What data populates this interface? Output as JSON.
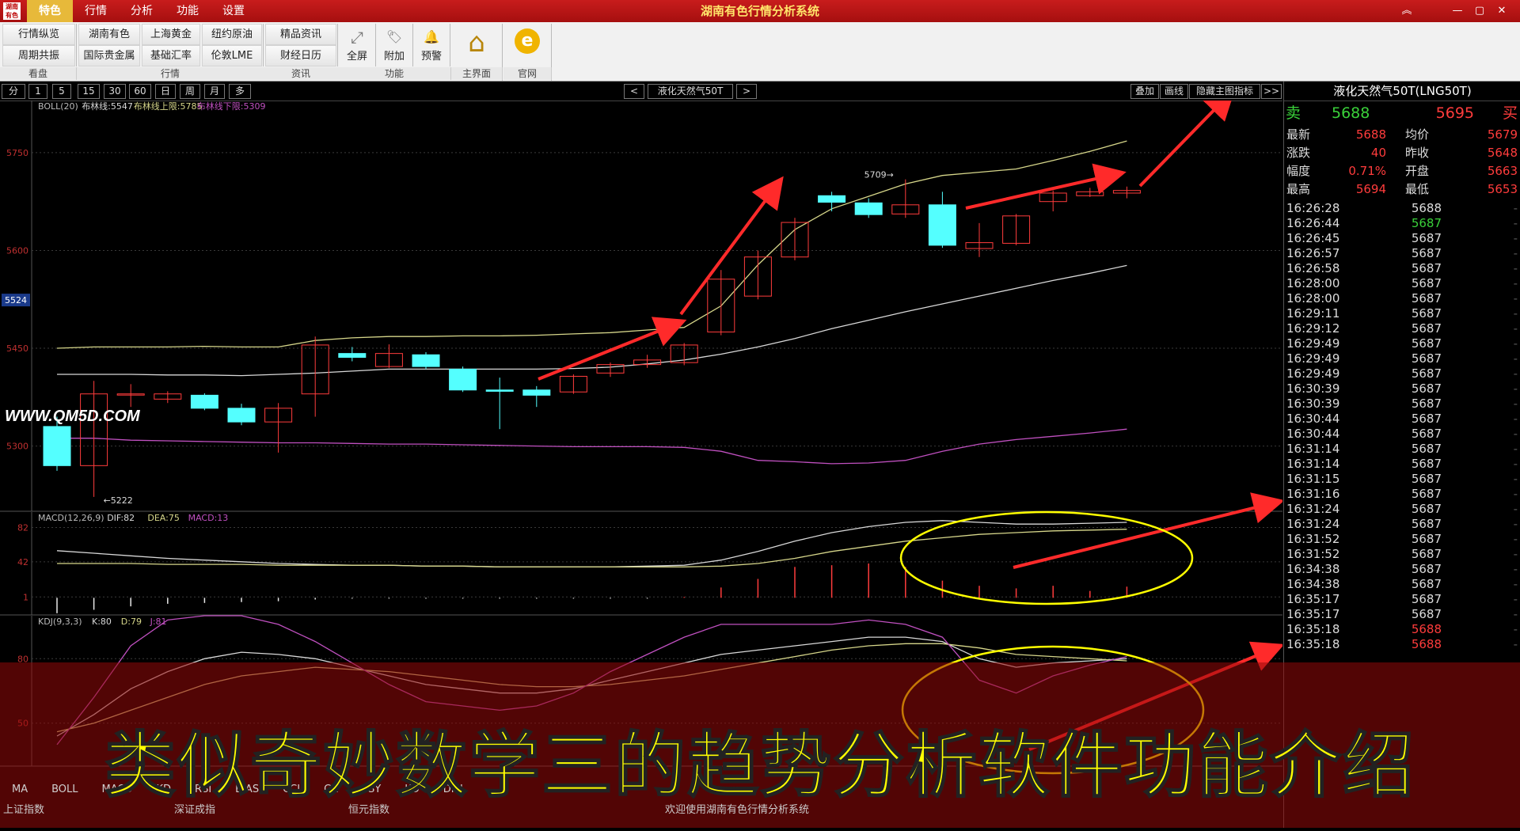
{
  "app": {
    "title": "湖南有色行情分析系统",
    "logo_text": "湖南有色"
  },
  "menu": [
    "特色",
    "行情",
    "分析",
    "功能",
    "设置"
  ],
  "window_controls": [
    "︽",
    "—",
    "▢",
    "✕"
  ],
  "toolbar": {
    "groups": [
      {
        "label": "看盘",
        "buttons": [
          "行情纵览",
          "周期共振"
        ]
      },
      {
        "label": "行情",
        "buttons": [
          "湖南有色",
          "上海黄金",
          "国际贵金属",
          "基础汇率",
          "纽约原油",
          "伦敦LME"
        ]
      },
      {
        "label": "资讯",
        "buttons": [
          "精品资讯",
          "财经日历"
        ]
      }
    ],
    "big_buttons": [
      {
        "label": "全屏",
        "icon": "fullscreen-icon",
        "glyph": "⤢"
      },
      {
        "label": "附加",
        "icon": "tag-icon",
        "glyph": "🏷"
      },
      {
        "label": "预警",
        "icon": "bell-icon",
        "glyph": "🔔"
      }
    ],
    "big_group_label": "功能",
    "home": {
      "label": "主界面",
      "icon": "home-icon",
      "glyph": "⌂"
    },
    "website": {
      "label": "官网",
      "icon": "globe-icon",
      "glyph": "e"
    }
  },
  "periods": [
    "分",
    "1",
    "5",
    "15",
    "30",
    "60",
    "日",
    "周",
    "月",
    "多"
  ],
  "symbol_nav": {
    "prev": "<",
    "name": "液化天然气50T",
    "next": ">"
  },
  "chart_tools": [
    "叠加",
    "画线",
    "隐藏主图指标",
    ">>"
  ],
  "watermark": "WWW.QM5D.COM",
  "chart_data": [
    {
      "type": "candlestick",
      "title": "BOLL(20)",
      "legend": [
        {
          "label": "布林线:5547",
          "color": "#d8d8d8"
        },
        {
          "label": "布林线上限:5785",
          "color": "#d6d68a"
        },
        {
          "label": "布林线下限:5309",
          "color": "#c050c0"
        }
      ],
      "ylim": [
        5200,
        5830
      ],
      "y_ticks": [
        5300,
        5450,
        5600,
        5750
      ],
      "current_price_label": "5524",
      "annotations": [
        {
          "text": "5709",
          "index": 23
        },
        {
          "text": "5222",
          "index": 1
        }
      ],
      "candles": [
        {
          "o": 5330,
          "c": 5270,
          "h": 5345,
          "l": 5262
        },
        {
          "o": 5270,
          "c": 5380,
          "h": 5400,
          "l": 5222
        },
        {
          "o": 5380,
          "c": 5380,
          "h": 5395,
          "l": 5360
        },
        {
          "o": 5372,
          "c": 5380,
          "h": 5384,
          "l": 5366
        },
        {
          "o": 5378,
          "c": 5358,
          "h": 5381,
          "l": 5355
        },
        {
          "o": 5358,
          "c": 5337,
          "h": 5365,
          "l": 5332
        },
        {
          "o": 5337,
          "c": 5358,
          "h": 5366,
          "l": 5290
        },
        {
          "o": 5380,
          "c": 5455,
          "h": 5468,
          "l": 5345
        },
        {
          "o": 5442,
          "c": 5436,
          "h": 5452,
          "l": 5430
        },
        {
          "o": 5422,
          "c": 5442,
          "h": 5456,
          "l": 5420
        },
        {
          "o": 5440,
          "c": 5422,
          "h": 5444,
          "l": 5418
        },
        {
          "o": 5418,
          "c": 5386,
          "h": 5422,
          "l": 5383
        },
        {
          "o": 5386,
          "c": 5384,
          "h": 5405,
          "l": 5326
        },
        {
          "o": 5386,
          "c": 5378,
          "h": 5392,
          "l": 5360
        },
        {
          "o": 5383,
          "c": 5407,
          "h": 5410,
          "l": 5380
        },
        {
          "o": 5412,
          "c": 5425,
          "h": 5428,
          "l": 5406
        },
        {
          "o": 5425,
          "c": 5432,
          "h": 5440,
          "l": 5420
        },
        {
          "o": 5428,
          "c": 5455,
          "h": 5458,
          "l": 5424
        },
        {
          "o": 5475,
          "c": 5556,
          "h": 5570,
          "l": 5470
        },
        {
          "o": 5530,
          "c": 5590,
          "h": 5600,
          "l": 5525
        },
        {
          "o": 5590,
          "c": 5643,
          "h": 5650,
          "l": 5585
        },
        {
          "o": 5684,
          "c": 5674,
          "h": 5690,
          "l": 5660
        },
        {
          "o": 5673,
          "c": 5655,
          "h": 5680,
          "l": 5650
        },
        {
          "o": 5656,
          "c": 5670,
          "h": 5709,
          "l": 5650
        },
        {
          "o": 5670,
          "c": 5608,
          "h": 5690,
          "l": 5604
        },
        {
          "o": 5603,
          "c": 5612,
          "h": 5642,
          "l": 5590
        },
        {
          "o": 5611,
          "c": 5653,
          "h": 5656,
          "l": 5608
        },
        {
          "o": 5675,
          "c": 5688,
          "h": 5692,
          "l": 5660
        },
        {
          "o": 5684,
          "c": 5690,
          "h": 5696,
          "l": 5682
        },
        {
          "o": 5688,
          "c": 5692,
          "h": 5698,
          "l": 5680
        }
      ],
      "mid": [
        5410,
        5410,
        5410,
        5409,
        5409,
        5408,
        5410,
        5412,
        5415,
        5418,
        5418,
        5418,
        5418,
        5418,
        5419,
        5421,
        5426,
        5432,
        5441,
        5452,
        5465,
        5480,
        5493,
        5506,
        5518,
        5530,
        5542,
        5554,
        5565,
        5577
      ],
      "upper": [
        5450,
        5452,
        5452,
        5452,
        5453,
        5452,
        5452,
        5462,
        5466,
        5468,
        5468,
        5469,
        5469,
        5470,
        5472,
        5474,
        5478,
        5482,
        5515,
        5578,
        5632,
        5664,
        5683,
        5702,
        5715,
        5720,
        5725,
        5738,
        5752,
        5768
      ],
      "lower": [
        5312,
        5312,
        5309,
        5308,
        5307,
        5306,
        5305,
        5305,
        5304,
        5303,
        5303,
        5302,
        5301,
        5300,
        5299,
        5299,
        5299,
        5298,
        5292,
        5278,
        5276,
        5273,
        5274,
        5278,
        5292,
        5303,
        5310,
        5315,
        5320,
        5326
      ]
    },
    {
      "type": "line",
      "title": "MACD(12,26,9)",
      "legend": [
        {
          "label": "DIF:82",
          "color": "#d8d8d8"
        },
        {
          "label": "DEA:75",
          "color": "#d6d68a"
        },
        {
          "label": "MACD:13",
          "color": "#c050c0"
        }
      ],
      "ylim": [
        -20,
        100
      ],
      "y_ticks": [
        1,
        42,
        82
      ],
      "dif": [
        55,
        52,
        49,
        46,
        44,
        42,
        40,
        39,
        38,
        38,
        37,
        37,
        36,
        36,
        36,
        36,
        37,
        38,
        44,
        54,
        66,
        76,
        83,
        88,
        90,
        88,
        86,
        86,
        87,
        88
      ],
      "dea": [
        40,
        40,
        40,
        39,
        39,
        39,
        38,
        38,
        38,
        38,
        37,
        37,
        36,
        36,
        36,
        36,
        36,
        36,
        37,
        40,
        46,
        54,
        60,
        66,
        70,
        74,
        76,
        78,
        79,
        80
      ],
      "macd": [
        -18,
        -14,
        -10,
        -7,
        -6,
        -5,
        -4,
        -2,
        -1,
        -1,
        -1,
        -1,
        -1,
        -1,
        -1,
        -1,
        -1,
        1,
        12,
        22,
        36,
        38,
        40,
        36,
        20,
        14,
        11,
        14,
        8,
        13
      ]
    },
    {
      "type": "line",
      "title": "KDJ(9,3,3)",
      "legend": [
        {
          "label": "K:80",
          "color": "#d8d8d8"
        },
        {
          "label": "D:79",
          "color": "#d6d68a"
        },
        {
          "label": "J:81",
          "color": "#c050c0"
        }
      ],
      "ylim": [
        30,
        100
      ],
      "y_ticks": [
        50,
        80
      ],
      "k": [
        44,
        54,
        66,
        74,
        80,
        83,
        82,
        80,
        76,
        72,
        68,
        66,
        64,
        64,
        66,
        70,
        74,
        78,
        82,
        84,
        86,
        88,
        90,
        90,
        88,
        80,
        76,
        78,
        79,
        80
      ],
      "d": [
        46,
        50,
        56,
        62,
        68,
        72,
        74,
        76,
        75,
        74,
        72,
        70,
        68,
        67,
        67,
        68,
        70,
        72,
        75,
        78,
        81,
        84,
        86,
        87,
        87,
        85,
        82,
        81,
        80,
        79
      ],
      "j": [
        40,
        62,
        86,
        98,
        100,
        100,
        96,
        88,
        78,
        68,
        60,
        58,
        56,
        58,
        64,
        74,
        82,
        90,
        96,
        96,
        96,
        96,
        98,
        96,
        90,
        70,
        64,
        72,
        77,
        81
      ]
    }
  ],
  "quote": {
    "title": "液化天然气50T(LNG50T)",
    "sell_label": "卖",
    "sell_price": "5688",
    "buy_price": "5695",
    "buy_label": "买",
    "stats": [
      {
        "l1": "最新",
        "v1": "5688",
        "l2": "均价",
        "v2": "5679"
      },
      {
        "l1": "涨跌",
        "v1": "40",
        "l2": "昨收",
        "v2": "5648"
      },
      {
        "l1": "幅度",
        "v1": "0.71%",
        "l2": "开盘",
        "v2": "5663"
      },
      {
        "l1": "最高",
        "v1": "5694",
        "l2": "最低",
        "v2": "5653"
      }
    ],
    "ticks": [
      {
        "time": "16:26:28",
        "price": "5688"
      },
      {
        "time": "16:26:44",
        "price": "5687"
      },
      {
        "time": "16:26:45",
        "price": "5687"
      },
      {
        "time": "16:26:57",
        "price": "5687"
      },
      {
        "time": "16:26:58",
        "price": "5687"
      },
      {
        "time": "16:28:00",
        "price": "5687"
      },
      {
        "time": "16:28:00",
        "price": "5687"
      },
      {
        "time": "16:29:11",
        "price": "5687"
      },
      {
        "time": "16:29:12",
        "price": "5687"
      },
      {
        "time": "16:29:49",
        "price": "5687"
      },
      {
        "time": "16:29:49",
        "price": "5687"
      },
      {
        "time": "16:29:49",
        "price": "5687"
      },
      {
        "time": "16:30:39",
        "price": "5687"
      },
      {
        "time": "16:30:39",
        "price": "5687"
      },
      {
        "time": "16:30:44",
        "price": "5687"
      },
      {
        "time": "16:30:44",
        "price": "5687"
      },
      {
        "time": "16:31:14",
        "price": "5687"
      },
      {
        "time": "16:31:14",
        "price": "5687"
      },
      {
        "time": "16:31:15",
        "price": "5687"
      },
      {
        "time": "16:31:16",
        "price": "5687"
      },
      {
        "time": "16:31:24",
        "price": "5687"
      },
      {
        "time": "16:31:24",
        "price": "5687"
      },
      {
        "time": "16:31:52",
        "price": "5687"
      },
      {
        "time": "16:31:52",
        "price": "5687"
      },
      {
        "time": "16:34:38",
        "price": "5687"
      },
      {
        "time": "16:34:38",
        "price": "5687"
      },
      {
        "time": "16:35:17",
        "price": "5687"
      },
      {
        "time": "16:35:17",
        "price": "5687"
      },
      {
        "time": "16:35:18",
        "price": "5688"
      },
      {
        "time": "16:35:18",
        "price": "5688"
      }
    ]
  },
  "indicator_tabs": [
    "MA",
    "BOLL",
    "MACD",
    "KD",
    "RSI",
    "BIAS",
    "CCI",
    "CR",
    "PSY",
    "KD",
    "DMI"
  ],
  "status": {
    "left1": "上证指数",
    "left2": "深证成指",
    "left3": "恒元指数",
    "center": "欢迎使用湖南有色行情分析系统"
  },
  "overlay_title": "类似奇妙数学三的趋势分析软件功能介绍",
  "colors": {
    "up": "#ff3c3c",
    "down": "#54ffff",
    "accent": "#ffff00",
    "arrow": "#ff2a2a"
  }
}
